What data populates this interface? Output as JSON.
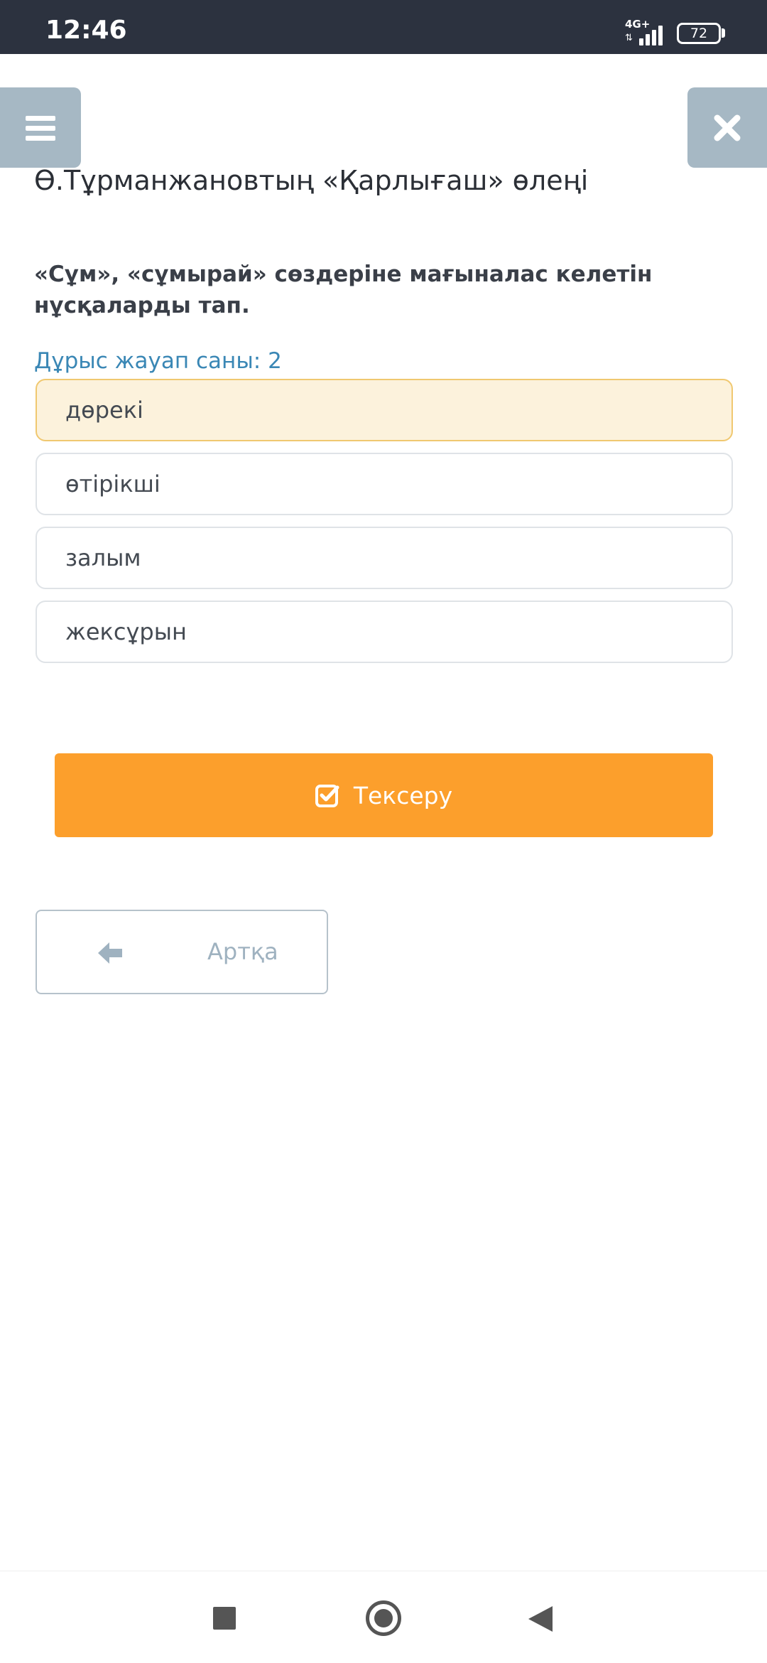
{
  "status_bar": {
    "time": "12:46",
    "network": "4G+",
    "battery": "72"
  },
  "header": {
    "menu_icon": "hamburger-menu-icon",
    "close_icon": "close-icon",
    "title": "Ө.Тұрманжановтың «Қарлығаш» өлеңі"
  },
  "quiz": {
    "question": "«Сұм», «сұмырай» сөздеріне мағыналас келетін нұсқаларды тап.",
    "answer_count": "Дұрыс жауап саны: 2",
    "options": [
      {
        "label": "дөрекі",
        "selected": true
      },
      {
        "label": "өтірікші",
        "selected": false
      },
      {
        "label": "залым",
        "selected": false
      },
      {
        "label": "жексұрын",
        "selected": false
      }
    ]
  },
  "actions": {
    "check_label": "Тексеру",
    "check_icon": "checkbox-check-icon",
    "back_label": "Артқа",
    "back_icon": "arrow-left-icon"
  },
  "colors": {
    "accent_orange": "#fc9f2c",
    "selected_bg": "#fcf2dc",
    "link_blue": "#3a87b5",
    "header_btn_bg": "#a6b8c4"
  }
}
